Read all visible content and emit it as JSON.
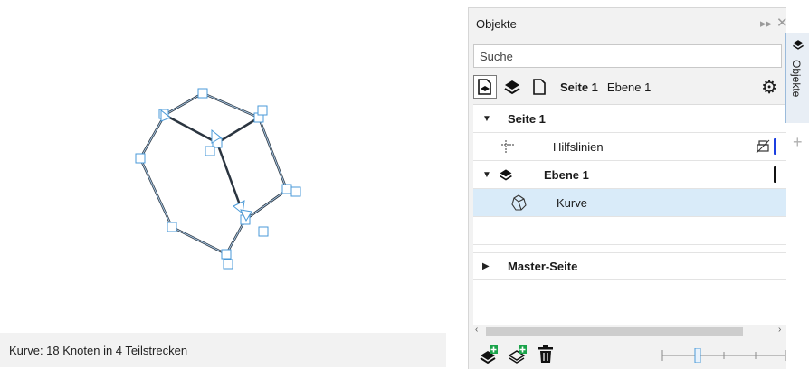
{
  "status": {
    "text": "Kurve: 18 Knoten in 4 Teilstrecken"
  },
  "panel": {
    "title": "Objekte",
    "search_placeholder": "Suche",
    "toolbar": {
      "page_label": "Seite 1",
      "layer_label": "Ebene 1"
    },
    "tree": [
      {
        "label": "Seite 1",
        "expanded": true
      },
      {
        "label": "Hilfslinien",
        "color": "#1c3fe0"
      },
      {
        "label": "Ebene 1",
        "expanded": true,
        "color": "#111111"
      },
      {
        "label": "Kurve",
        "selected": true
      },
      {
        "label": "Master-Seite",
        "expanded": false
      }
    ],
    "side_tab": "Objekte"
  },
  "icons": [
    "fast-forward-icon",
    "close-icon",
    "page-layers-icon",
    "layers-icon",
    "page-icon",
    "gear-icon",
    "guidelines-icon",
    "layer-icon",
    "curve-shape-icon",
    "print-disabled-icon",
    "new-layer-icon",
    "new-master-layer-icon",
    "trash-icon",
    "plus-icon"
  ],
  "colors": {
    "selection": "#d9ebf9",
    "handle": "#4a9ad8",
    "curve_stroke": "#2b3540"
  }
}
